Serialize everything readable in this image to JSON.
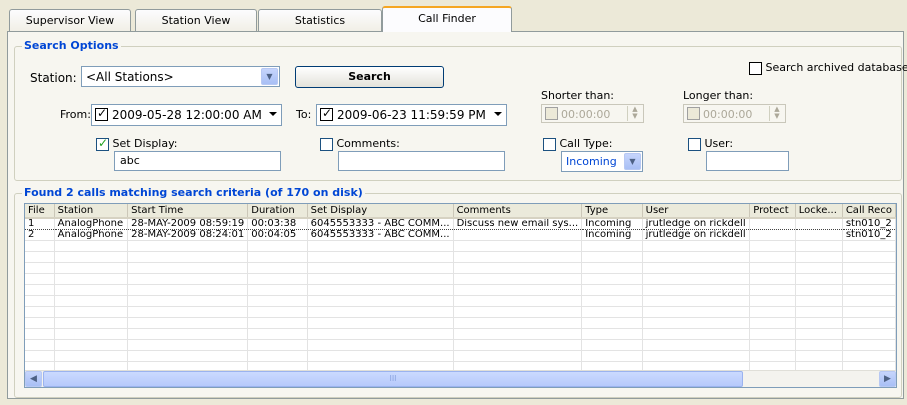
{
  "tabs": [
    {
      "label": "Supervisor View"
    },
    {
      "label": "Station View"
    },
    {
      "label": "Statistics"
    },
    {
      "label": "Call Finder"
    }
  ],
  "search_options": {
    "title": "Search Options",
    "station_label": "Station:",
    "station_value": "<All Stations>",
    "search_button": "Search",
    "archived_label": "Search archived database.",
    "from_label": "From:",
    "from_value": "2009-05-28 12:00:00 AM",
    "to_label": "To:",
    "to_value": "2009-06-23 11:59:59 PM",
    "shorter_label": "Shorter than:",
    "shorter_value": "00:00:00",
    "longer_label": "Longer than:",
    "longer_value": "00:00:00",
    "set_display_label": "Set Display:",
    "set_display_value": "abc",
    "comments_label": "Comments:",
    "comments_value": "",
    "call_type_label": "Call Type:",
    "call_type_value": "Incoming",
    "user_label": "User:",
    "user_value": ""
  },
  "results": {
    "title": "Found 2 calls matching search criteria (of 170 on disk)",
    "columns": [
      "File",
      "Station",
      "Start Time",
      "Duration",
      "Set Display",
      "Comments",
      "Type",
      "User",
      "Protect",
      "Locke...",
      "Call Reco"
    ],
    "rows": [
      [
        "1",
        "AnalogPhone",
        "28-MAY-2009 08:59:19",
        "00:03:38",
        "6045553333 - ABC COMM...",
        "Discuss new email sys...",
        "Incoming",
        "jrutledge on rickdell",
        "",
        "",
        "stn010_2"
      ],
      [
        "2",
        "AnalogPhone",
        "28-MAY-2009 08:24:01",
        "00:04:05",
        "6045553333 - ABC COMM...",
        "",
        "Incoming",
        "jrutledge on rickdell",
        "",
        "",
        "stn010_2"
      ]
    ],
    "scroll_thumb_label": "III"
  },
  "icons": {
    "combo_arrow": "chevron-down-icon",
    "scroll_left": "scroll-left-icon",
    "scroll_right": "scroll-right-icon"
  },
  "colors": {
    "group_title": "#0046d5",
    "active_tab_accent": "#f5a623",
    "window_bg": "#ece9d8"
  }
}
